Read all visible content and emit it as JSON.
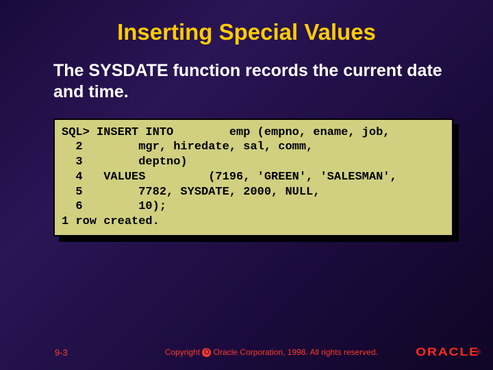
{
  "title": "Inserting Special Values",
  "subtitle": "The SYSDATE function records the current date and time.",
  "code": {
    "line1": "SQL> INSERT INTO\temp (empno, ename, job,",
    "line2": "  2        mgr, hiredate, sal, comm,",
    "line3": "  3        deptno)",
    "line4": "  4   VALUES         (7196, 'GREEN', 'SALESMAN',",
    "line5": "  5        7782, SYSDATE, 2000, NULL,",
    "line6": "  6        10);",
    "line7": "1 row created."
  },
  "footer": {
    "page": "9-3",
    "copyright_prefix": "Copyright ",
    "copyright_suffix": " Oracle Corporation, 1998. All rights reserved.",
    "logo": "ORACLE",
    "registered": "®"
  }
}
